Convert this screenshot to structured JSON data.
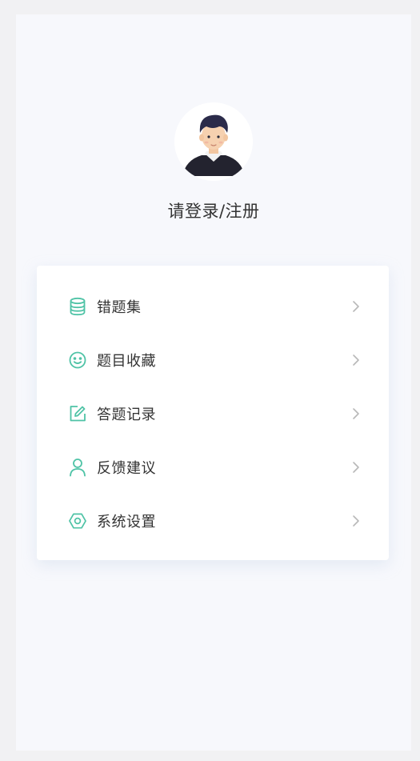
{
  "profile": {
    "login_label": "请登录/注册"
  },
  "menu": {
    "items": [
      {
        "label": "错题集",
        "icon": "database-icon"
      },
      {
        "label": "题目收藏",
        "icon": "smiley-icon"
      },
      {
        "label": "答题记录",
        "icon": "edit-icon"
      },
      {
        "label": "反馈建议",
        "icon": "user-icon"
      },
      {
        "label": "系统设置",
        "icon": "settings-icon"
      }
    ]
  },
  "colors": {
    "accent": "#4fc3a6",
    "text": "#333333",
    "chevron": "#b8b8b8",
    "page_background": "#f7f8fc",
    "card_background": "#ffffff"
  }
}
